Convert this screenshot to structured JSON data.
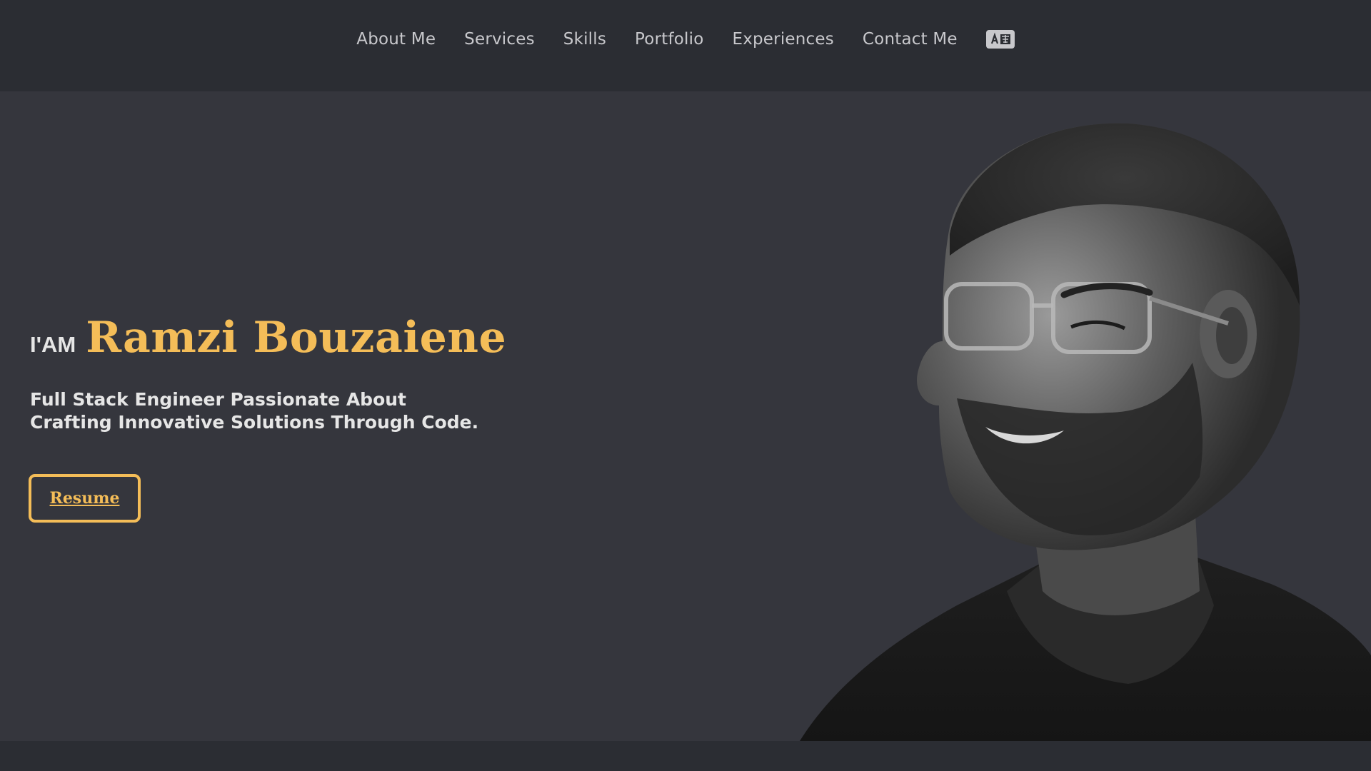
{
  "nav": {
    "items": [
      {
        "label": "About Me"
      },
      {
        "label": "Services"
      },
      {
        "label": "Skills"
      },
      {
        "label": "Portfolio"
      },
      {
        "label": "Experiences"
      },
      {
        "label": "Contact Me"
      }
    ],
    "language_icon": "translate-icon"
  },
  "hero": {
    "prefix": "I'AM",
    "name": "Ramzi Bouzaiene",
    "tagline_line1": "Full Stack Engineer Passionate About",
    "tagline_line2": "Crafting Innovative Solutions Through Code.",
    "resume_label": "Resume",
    "portrait": "profile-photo"
  },
  "colors": {
    "accent": "#f4bd58",
    "nav_bg": "#2b2d33",
    "hero_bg": "#35363d",
    "nav_text": "#c8c8cc",
    "body_text": "#e6e6e6"
  }
}
